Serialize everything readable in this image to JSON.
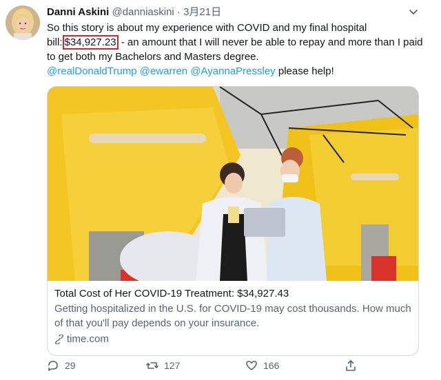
{
  "tweet": {
    "author_name": "Danni Askini",
    "author_handle": "@danniaskini",
    "separator": "·",
    "date": "3月21日",
    "text_before": "So this story is about my experience with COVID and my final hospital bill:",
    "amount": "$34,927.23",
    "text_after": " - an amount that I will never be able to repay and more than I paid to get both my Bachelors and Masters degree.",
    "mentions": [
      "@realDonaldTrump",
      "@ewarren",
      "@AyannaPressley"
    ],
    "closing_text": " please help!"
  },
  "card": {
    "title": "Total Cost of Her COVID-19 Treatment: $34,927.43",
    "description": "Getting hospitalized in the U.S. for COVID-19 may cost thousands. How much of that you'll pay depends on your insurance.",
    "domain": "time.com"
  },
  "actions": {
    "reply_count": "29",
    "retweet_count": "127",
    "like_count": "166"
  },
  "icons": {
    "menu": "chevron-down-icon",
    "link": "link-icon",
    "reply": "reply-icon",
    "retweet": "retweet-icon",
    "like": "heart-icon",
    "share": "share-icon"
  },
  "colors": {
    "accent": "#1d9bf0",
    "highlight_box": "#d6242a",
    "tent_yellow": "#f3c623"
  }
}
